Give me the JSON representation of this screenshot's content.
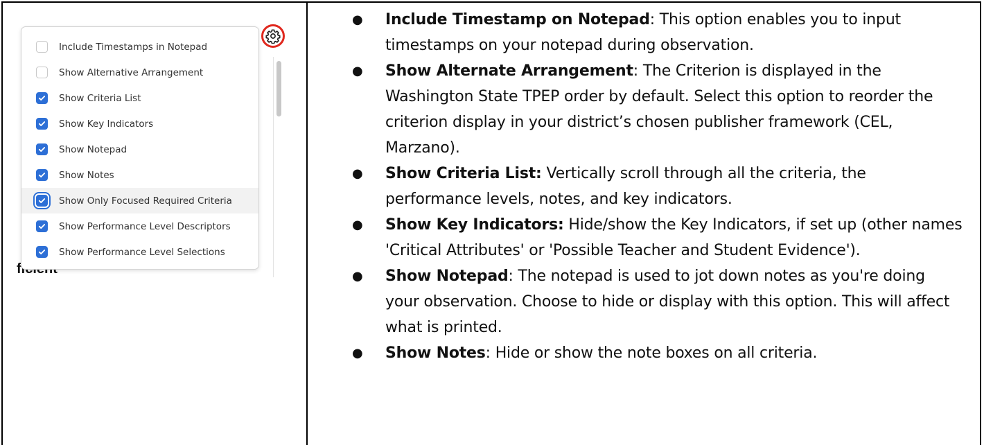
{
  "settings_menu": {
    "gear_icon": "gear-icon",
    "items": [
      {
        "label": "Include Timestamps in Notepad",
        "checked": false,
        "focused": false
      },
      {
        "label": "Show Alternative Arrangement",
        "checked": false,
        "focused": false
      },
      {
        "label": "Show Criteria List",
        "checked": true,
        "focused": false
      },
      {
        "label": "Show Key Indicators",
        "checked": true,
        "focused": false
      },
      {
        "label": "Show Notepad",
        "checked": true,
        "focused": false
      },
      {
        "label": "Show Notes",
        "checked": true,
        "focused": false
      },
      {
        "label": "Show Only Focused Required Criteria",
        "checked": true,
        "focused": true
      },
      {
        "label": "Show Performance Level Descriptors",
        "checked": true,
        "focused": false
      },
      {
        "label": "Show Performance Level Selections",
        "checked": true,
        "focused": false
      }
    ],
    "background_fragment": "ficient",
    "highlight_color": "#e0281e",
    "checkbox_color": "#2d6fd6"
  },
  "descriptions": [
    {
      "term": "Include Timestamp on Notepad",
      "separator": ": ",
      "text": "This option enables you to input timestamps on your notepad during observation."
    },
    {
      "term": "Show Alternate Arrangement",
      "separator": ": ",
      "text": "The Criterion is displayed in the Washington State TPEP order by default. Select this option to reorder the criterion display in your district’s chosen publisher framework (CEL, Marzano)."
    },
    {
      "term": "Show Criteria List:",
      "separator": " ",
      "text": "Vertically scroll through all the criteria, the performance levels, notes, and key indicators."
    },
    {
      "term": "Show Key Indicators:",
      "separator": " ",
      "text": "Hide/show the Key Indicators, if set up (other names 'Critical Attributes' or 'Possible Teacher and Student Evidence')."
    },
    {
      "term": "Show Notepad",
      "separator": ": ",
      "text": "The notepad is used to jot down notes as you're doing your observation. Choose to hide or display with this option. This will affect what is printed."
    },
    {
      "term": "Show Notes",
      "separator": ": ",
      "text": "Hide or show the note boxes on all criteria."
    }
  ]
}
